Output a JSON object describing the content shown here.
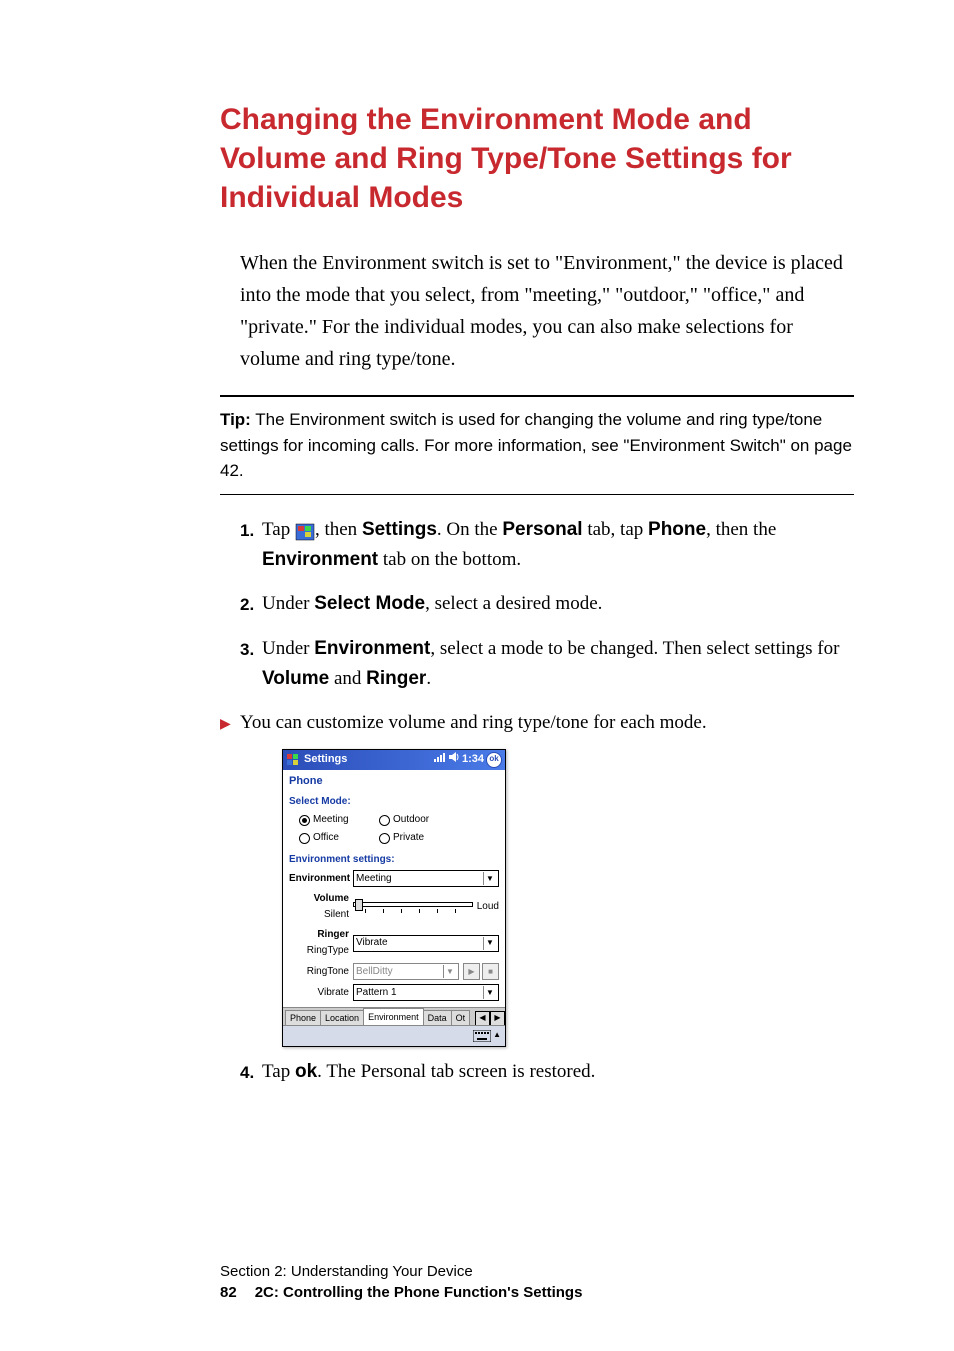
{
  "heading": "Changing the Environment Mode and Volume and Ring Type/Tone Settings for Individual Modes",
  "intro": "When the Environment switch is set to \"Environment,\" the device is placed into the mode that you select, from \"meeting,\" \"outdoor,\" \"office,\" and \"private.\" For the individual modes, you can also make selections for volume and ring type/tone.",
  "tip": {
    "label": "Tip:",
    "text": " The Environment switch is used for changing the volume and ring type/tone settings for incoming calls. For more information, see \"Environment Switch\" on page 42."
  },
  "steps": {
    "s1": {
      "num": "1.",
      "pre": "Tap ",
      "mid": ", then ",
      "b1": "Settings",
      "t2": ". On the ",
      "b2": "Personal",
      "t3": " tab, tap ",
      "b3": "Phone",
      "t4": ", then the ",
      "b4": "Environment",
      "t5": " tab on the bottom."
    },
    "s2": {
      "num": "2.",
      "pre": "Under ",
      "b1": "Select Mode",
      "t2": ", select a desired mode."
    },
    "s3": {
      "num": "3.",
      "pre": "Under ",
      "b1": "Environment",
      "t2": ", select a mode to be changed. Then select settings for ",
      "b2": "Volume",
      "t3": " and ",
      "b3": "Ringer",
      "t4": "."
    },
    "bullet": "You can customize volume and ring type/tone for each mode.",
    "s4": {
      "num": "4.",
      "pre": "Tap ",
      "b1": "ok",
      "t2": ". The Personal tab screen is restored."
    }
  },
  "screenshot": {
    "title": "Settings",
    "time": "1:34",
    "ok": "ok",
    "header": "Phone",
    "select_mode_label": "Select Mode:",
    "radios": {
      "meeting": "Meeting",
      "outdoor": "Outdoor",
      "office": "Office",
      "private": "Private"
    },
    "env_settings_label": "Environment settings:",
    "env_label": "Environment",
    "env_value": "Meeting",
    "vol_label": "Volume",
    "vol_silent": "Silent",
    "vol_loud": "Loud",
    "ringer_label": "Ringer",
    "ringtype_label": "RingType",
    "ringtype_value": "Vibrate",
    "ringtone_label": "RingTone",
    "ringtone_value": "BellDitty",
    "vibrate_label": "Vibrate",
    "vibrate_value": "Pattern 1",
    "tabs": {
      "phone": "Phone",
      "location": "Location",
      "environment": "Environment",
      "data": "Data",
      "ot": "Ot"
    }
  },
  "footer": {
    "section": "Section 2: Understanding Your Device",
    "page_num": "82",
    "subtitle": "2C: Controlling the Phone Function's Settings"
  }
}
